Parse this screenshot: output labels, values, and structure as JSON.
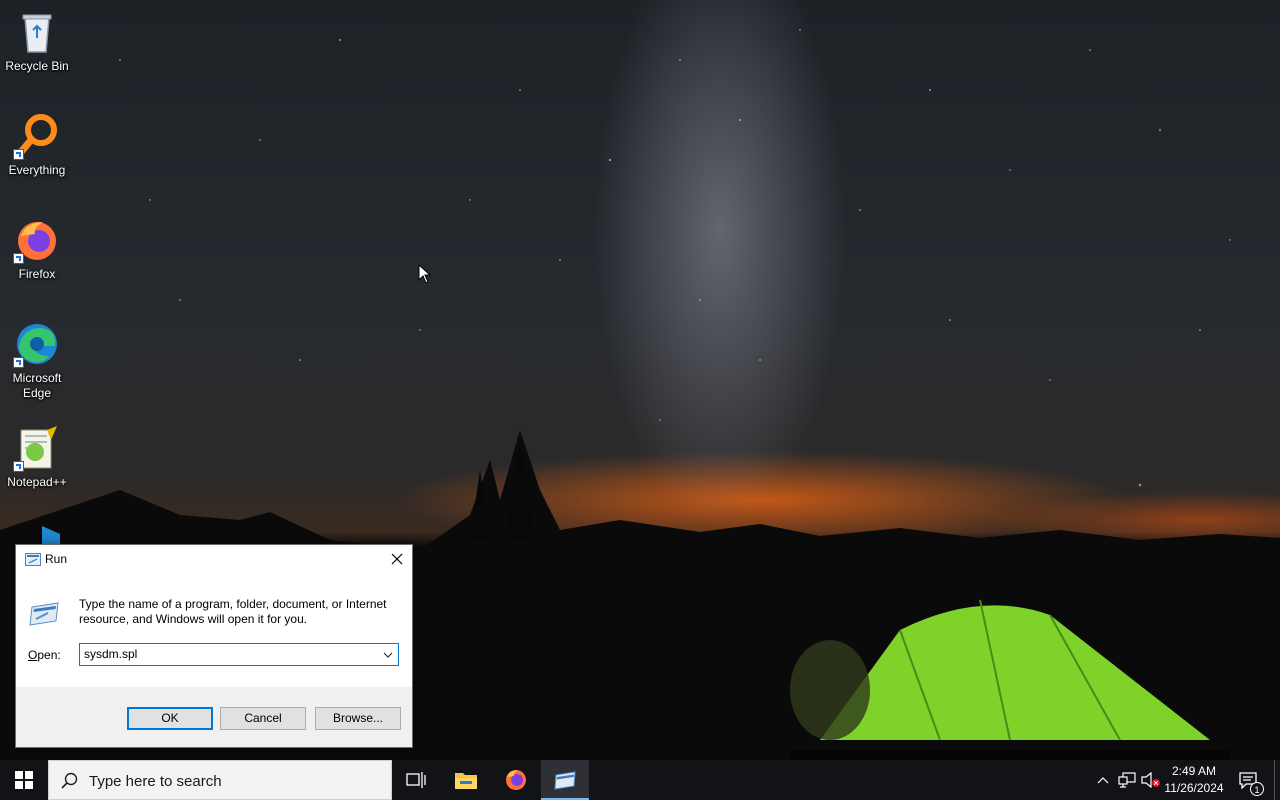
{
  "desktop": {
    "icons": [
      {
        "label": "Recycle Bin",
        "icon": "recycle-bin-icon"
      },
      {
        "label": "Everything",
        "icon": "everything-search-icon"
      },
      {
        "label": "Firefox",
        "icon": "firefox-icon"
      },
      {
        "label": "Microsoft Edge",
        "icon": "edge-icon"
      },
      {
        "label": "Notepad++",
        "icon": "notepadpp-icon"
      }
    ]
  },
  "run_dialog": {
    "title": "Run",
    "description": "Type the name of a program, folder, document, or Internet resource, and Windows will open it for you.",
    "open_label_prefix": "",
    "open_label_underlined": "O",
    "open_label_rest": "pen:",
    "open_value": "sysdm.spl",
    "ok_label": "OK",
    "cancel_label": "Cancel",
    "browse_label": "Browse..."
  },
  "taskbar": {
    "search_placeholder": "Type here to search",
    "clock_time": "2:49 AM",
    "clock_date": "11/26/2024",
    "notification_count": "1",
    "accent_color": "#76b9ed"
  }
}
